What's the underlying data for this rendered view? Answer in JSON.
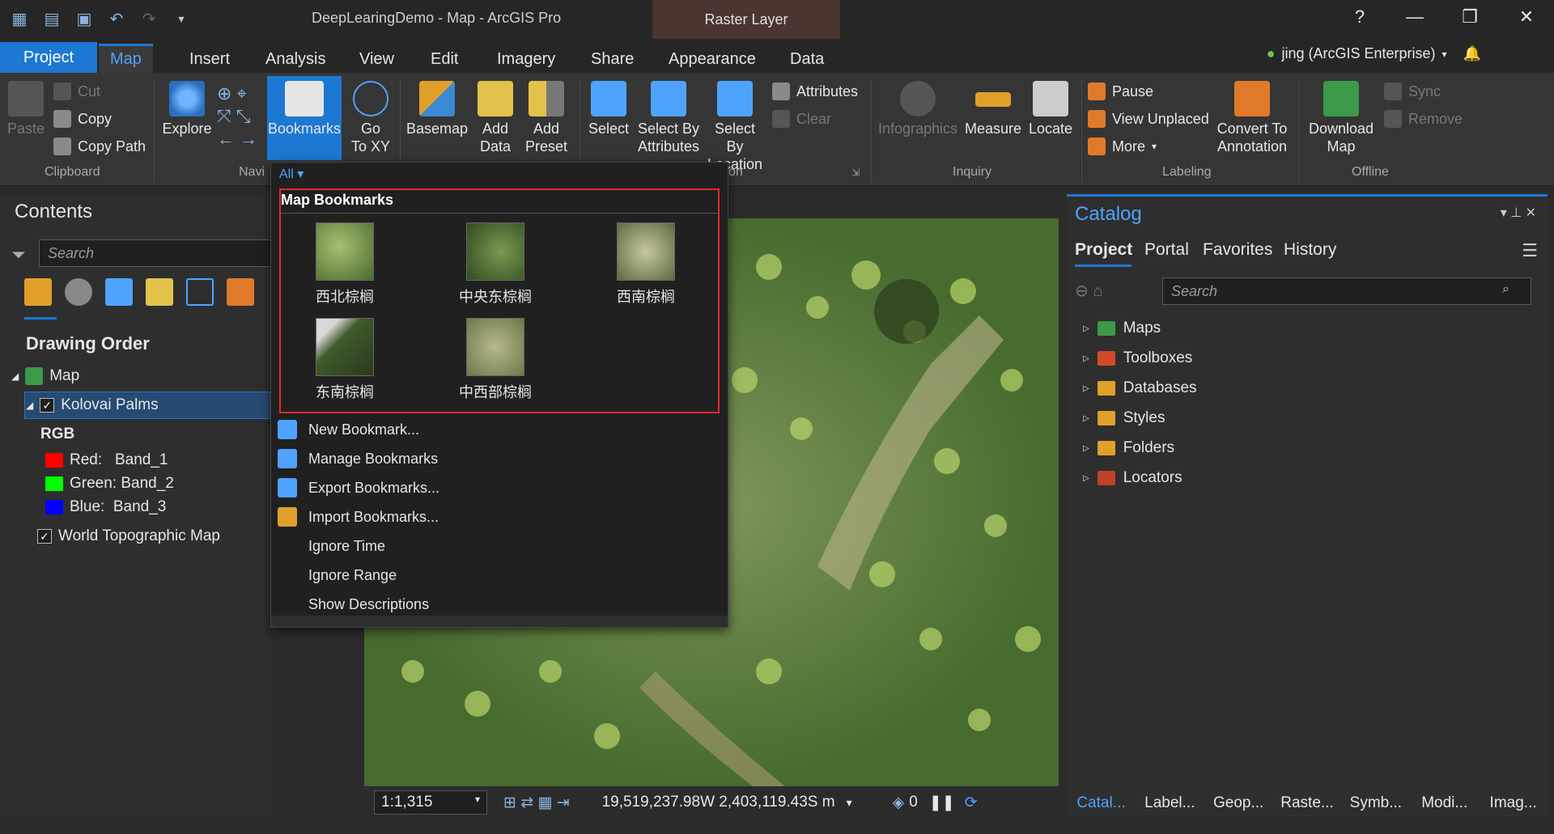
{
  "window": {
    "title": "DeepLearingDemo - Map - ArcGIS Pro",
    "context_tab": "Raster Layer",
    "help": "?",
    "minimize": "—",
    "restore": "❐",
    "close": "✕"
  },
  "tabs": [
    "Project",
    "Map",
    "Insert",
    "Analysis",
    "View",
    "Edit",
    "Imagery",
    "Share",
    "Appearance",
    "Data"
  ],
  "user": {
    "name": "jing (ArcGIS Enterprise)"
  },
  "ribbon": {
    "clipboard": {
      "paste": "Paste",
      "cut": "Cut",
      "copy": "Copy",
      "copy_path": "Copy Path",
      "group": "Clipboard"
    },
    "navigate": {
      "explore": "Explore",
      "bookmarks": "Bookmarks",
      "goto_1": "Go",
      "goto_2": "To XY",
      "group": "Navi"
    },
    "layer": {
      "basemap": "Basemap",
      "add_data_1": "Add",
      "add_data_2": "Data",
      "add_preset_1": "Add",
      "add_preset_2": "Preset"
    },
    "selection": {
      "select": "Select",
      "select_attr_1": "Select By",
      "select_attr_2": "Attributes",
      "select_loc_1": "Select By",
      "select_loc_2": "Location",
      "attributes": "Attributes",
      "clear": "Clear",
      "group": "on"
    },
    "inquiry": {
      "infographics": "Infographics",
      "measure": "Measure",
      "locate": "Locate",
      "group": "Inquiry"
    },
    "labeling": {
      "pause": "Pause",
      "view_unplaced": "View Unplaced",
      "more": "More",
      "convert_1": "Convert To",
      "convert_2": "Annotation",
      "group": "Labeling"
    },
    "offline": {
      "download_1": "Download",
      "download_2": "Map",
      "sync": "Sync",
      "remove": "Remove",
      "group": "Offline"
    }
  },
  "contents": {
    "title": "Contents",
    "search_placeholder": "Search",
    "drawing_order": "Drawing Order",
    "map": "Map",
    "layer": "Kolovai Palms",
    "rgb": "RGB",
    "red": "Red:   Band_1",
    "green": "Green: Band_2",
    "blue": "Blue:  Band_3",
    "basemap": "World Topographic Map"
  },
  "dropdown": {
    "filter": "All",
    "header": "Map Bookmarks",
    "bookmarks": [
      "西北棕榈",
      "中央东棕榈",
      "西南棕榈",
      "东南棕榈",
      "中西部棕榈"
    ],
    "menu": [
      "New Bookmark...",
      "Manage Bookmarks",
      "Export Bookmarks...",
      "Import Bookmarks...",
      "Ignore Time",
      "Ignore Range",
      "Show Descriptions"
    ]
  },
  "status": {
    "scale": "1:1,315",
    "coords": "19,519,237.98W 2,403,119.43S m",
    "count": "0"
  },
  "catalog": {
    "title": "Catalog",
    "tabs": [
      "Project",
      "Portal",
      "Favorites",
      "History"
    ],
    "search_placeholder": "Search",
    "items": [
      "Maps",
      "Toolboxes",
      "Databases",
      "Styles",
      "Folders",
      "Locators"
    ]
  },
  "bottom_tabs": [
    "Catal...",
    "Label...",
    "Geop...",
    "Raste...",
    "Symb...",
    "Modi...",
    "Imag..."
  ],
  "colors": {
    "accent": "#1c78d3",
    "highlight_box": "#e02a2a",
    "red_band": "#ff0000",
    "green_band": "#00ff00",
    "blue_band": "#0000ff"
  }
}
